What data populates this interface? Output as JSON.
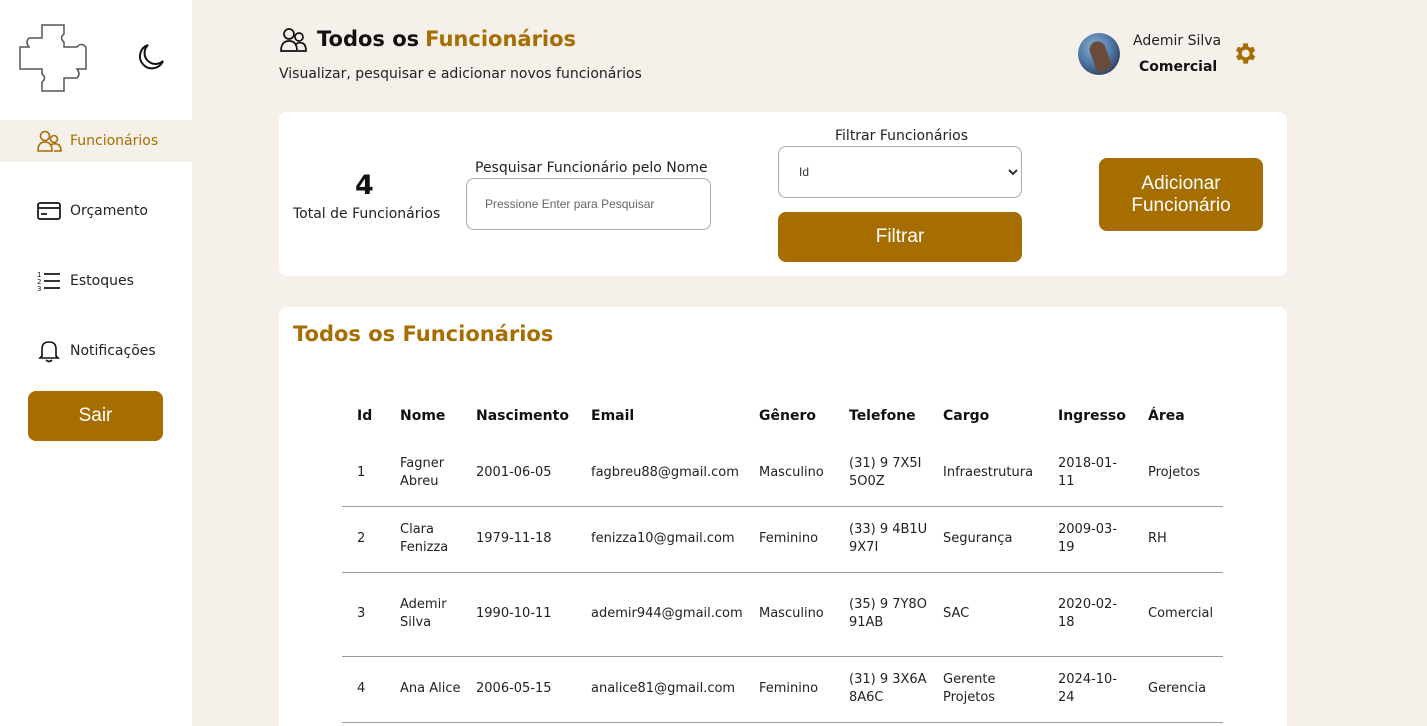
{
  "sidebar": {
    "items": [
      {
        "label": "Funcionários",
        "icon": "users-icon",
        "active": true
      },
      {
        "label": "Orçamento",
        "icon": "credit-card-icon",
        "active": false
      },
      {
        "label": "Estoques",
        "icon": "numbered-list-icon",
        "active": false
      },
      {
        "label": "Notificações",
        "icon": "bell-icon",
        "active": false
      }
    ],
    "logout_label": "Sair"
  },
  "header": {
    "title_prefix": "Todos os",
    "title_accent": "Funcionários",
    "subtitle": "Visualizar, pesquisar e adicionar novos funcionários"
  },
  "user": {
    "name": "Ademir Silva",
    "area": "Comercial"
  },
  "summary": {
    "total": "4",
    "total_label": "Total de Funcionários"
  },
  "search": {
    "label": "Pesquisar Funcionário pelo Nome",
    "placeholder": "Pressione Enter para Pesquisar"
  },
  "filter": {
    "label": "Filtrar Funcionários",
    "selected": "Id",
    "button_label": "Filtrar"
  },
  "add_button_label": "Adicionar Funcionário",
  "table": {
    "title": "Todos os Funcionários",
    "columns": [
      "Id",
      "Nome",
      "Nascimento",
      "Email",
      "Gênero",
      "Telefone",
      "Cargo",
      "Ingresso",
      "Área"
    ],
    "rows": [
      [
        "1",
        "Fagner Abreu",
        "2001-06-05",
        "fagbreu88@gmail.com",
        "Masculino",
        "(31) 9 7X5I 5O0Z",
        "Infraestrutura",
        "2018-01-11",
        "Projetos"
      ],
      [
        "2",
        "Clara Fenizza",
        "1979-11-18",
        "fenizza10@gmail.com",
        "Feminino",
        "(33) 9 4B1U 9X7I",
        "Segurança",
        "2009-03-19",
        "RH"
      ],
      [
        "3",
        "Ademir Silva",
        "1990-10-11",
        "ademir944@gmail.com",
        "Masculino",
        "(35) 9 7Y8O 91AB",
        "SAC",
        "2020-02-18",
        "Comercial"
      ],
      [
        "4",
        "Ana Alice",
        "2006-05-15",
        "analice81@gmail.com",
        "Feminino",
        "(31) 9 3X6A 8A6C",
        "Gerente Projetos",
        "2024-10-24",
        "Gerencia"
      ]
    ]
  },
  "colors": {
    "accent": "#a66d00",
    "background": "#f6f0ea"
  }
}
